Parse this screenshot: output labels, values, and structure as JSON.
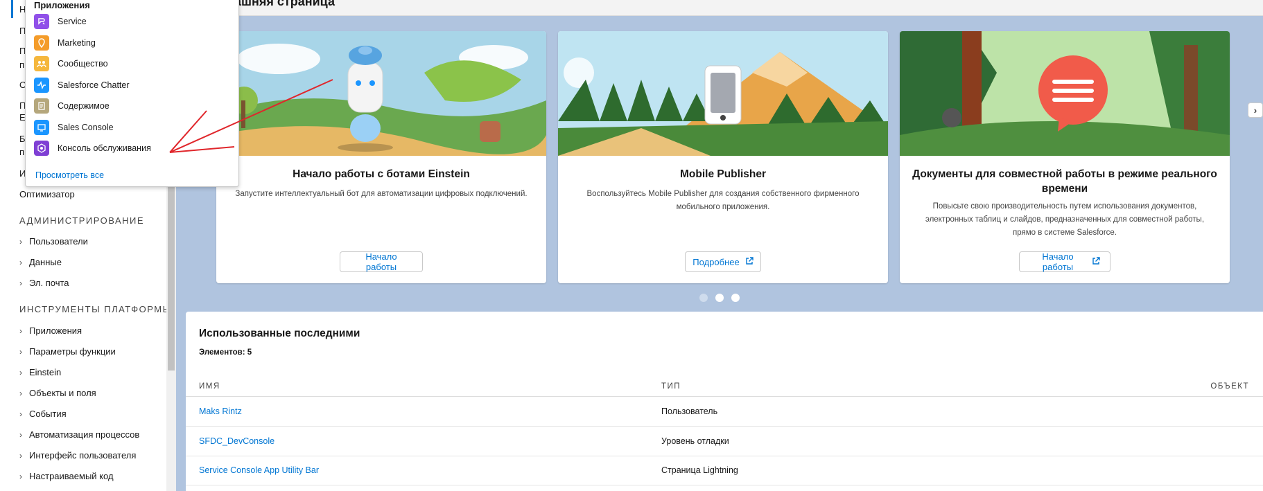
{
  "page": {
    "title": "ашняя страница"
  },
  "sidebar": {
    "peek": [
      "Н",
      "П",
      "П",
      "п",
      "О",
      "П",
      "E",
      "Б",
      "п",
      "И"
    ],
    "optimizer": "Оптимизатор",
    "admin_header": "Администрирование",
    "admin_items": [
      "Пользователи",
      "Данные",
      "Эл. почта"
    ],
    "platform_header": "Инструменты платформы",
    "platform_items": [
      "Приложения",
      "Параметры функции",
      "Einstein",
      "Объекты и поля",
      "События",
      "Автоматизация процессов",
      "Интерфейс пользователя",
      "Настраиваемый код"
    ]
  },
  "dropdown": {
    "header": "Приложения",
    "items": [
      {
        "label": "Service",
        "icon": "service-icon",
        "color": "#9050e9"
      },
      {
        "label": "Marketing",
        "icon": "marketing-icon",
        "color": "#f49c2a"
      },
      {
        "label": "Сообщество",
        "icon": "community-icon",
        "color": "#f5b73d"
      },
      {
        "label": "Salesforce Chatter",
        "icon": "chatter-icon",
        "color": "#1b96ff"
      },
      {
        "label": "Содержимое",
        "icon": "content-icon",
        "color": "#b5a77c"
      },
      {
        "label": "Sales Console",
        "icon": "sales-console-icon",
        "color": "#1b96ff"
      },
      {
        "label": "Консоль обслуживания",
        "icon": "service-console-icon",
        "color": "#7f3fd4"
      }
    ],
    "view_all": "Просмотреть все"
  },
  "cards": [
    {
      "title": "Начало работы с ботами Einstein",
      "desc": "Запустите интеллектуальный бот для автоматизации цифровых подключений.",
      "button": "Начало работы"
    },
    {
      "title": "Mobile Publisher",
      "desc": "Воспользуйтесь Mobile Publisher для создания собственного фирменного мобильного приложения.",
      "button": "Подробнее"
    },
    {
      "title": "Документы для совместной работы в режиме реального времени",
      "desc": "Повысьте свою производительность путем использования документов, электронных таблиц и слайдов, предназначенных для совместной работы, прямо в системе Salesforce.",
      "button": "Начало работы"
    }
  ],
  "carousel": {
    "active_index": 1,
    "count": 3
  },
  "recent": {
    "title": "Использованные последними",
    "count": "Элементов: 5",
    "columns": [
      "Имя",
      "Тип",
      "Объект"
    ],
    "rows": [
      {
        "name": "Maks Rintz",
        "type": "Пользователь"
      },
      {
        "name": "SFDC_DevConsole",
        "type": "Уровень отладки"
      },
      {
        "name": "Service Console App Utility Bar",
        "type": "Страница Lightning"
      }
    ]
  },
  "colors": {
    "brand": "#0176d3",
    "background": "#b0c4df",
    "annotation_arrow": "#e0262b"
  }
}
